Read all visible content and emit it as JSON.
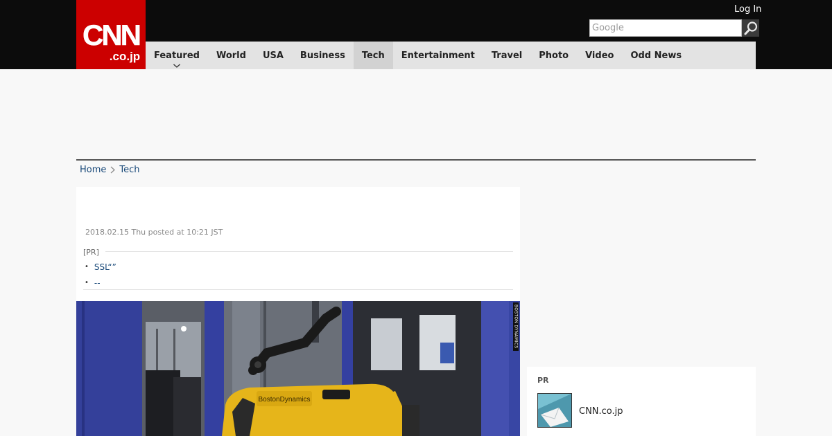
{
  "header": {
    "logo_top": "CNN",
    "logo_bottom": ".co.jp",
    "login_label": "Log In",
    "search_placeholder": "Google"
  },
  "nav": {
    "items": [
      {
        "label": "Featured",
        "has_dropdown": true
      },
      {
        "label": "World"
      },
      {
        "label": "USA"
      },
      {
        "label": "Business"
      },
      {
        "label": "Tech",
        "active": true
      },
      {
        "label": "Entertainment"
      },
      {
        "label": "Travel"
      },
      {
        "label": "Photo"
      },
      {
        "label": "Video"
      },
      {
        "label": "Odd News"
      }
    ]
  },
  "breadcrumb": {
    "home": "Home",
    "current": "Tech"
  },
  "article": {
    "posted": "2018.02.15 Thu posted at 10:21 JST",
    "pr_label": "[PR]",
    "pr_links": [
      "SSL“”",
      "--"
    ],
    "photo_credit": "BOSTON DYNAMICS",
    "robot_brand": "BostonDynamics"
  },
  "sidebar": {
    "pr_title": "PR",
    "pr_item_text": "CNN.co.jp"
  },
  "colors": {
    "brand_red": "#cc0000",
    "header_bg": "#0c0c0c",
    "nav_bg": "#e3e3e3",
    "link": "#1a4a7a"
  }
}
